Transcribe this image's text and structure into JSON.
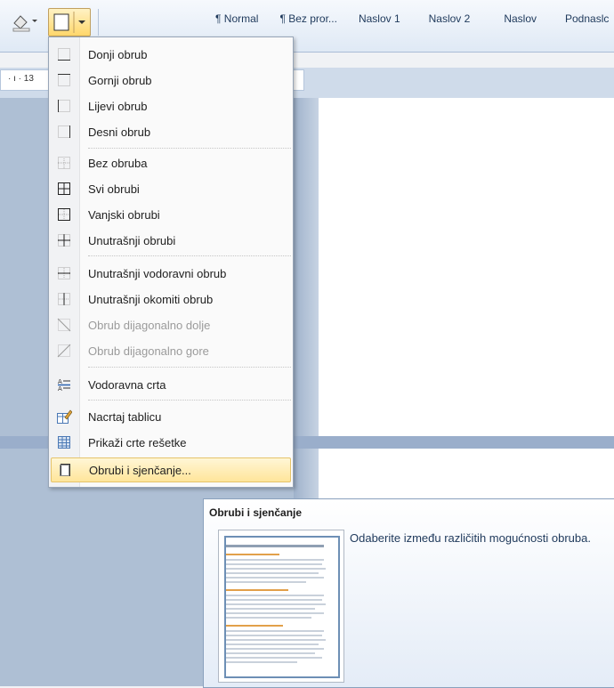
{
  "ribbon": {
    "styles": [
      "¶ Normal",
      "¶ Bez pror...",
      "Naslov 1",
      "Naslov 2",
      "Naslov",
      "Podnaslc"
    ]
  },
  "ruler": {
    "text": "· ı · 13"
  },
  "menu": {
    "items": [
      {
        "label": "Donji obrub",
        "icon": "border-bottom-icon",
        "disabled": false
      },
      {
        "label": "Gornji obrub",
        "icon": "border-top-icon",
        "disabled": false
      },
      {
        "label": "Lijevi obrub",
        "icon": "border-left-icon",
        "disabled": false
      },
      {
        "label": "Desni obrub",
        "icon": "border-right-icon",
        "disabled": false
      },
      {
        "label": "Bez obruba",
        "icon": "no-border-icon",
        "disabled": false
      },
      {
        "label": "Svi obrubi",
        "icon": "all-borders-icon",
        "disabled": false
      },
      {
        "label": "Vanjski obrubi",
        "icon": "outside-borders-icon",
        "disabled": false
      },
      {
        "label": "Unutrašnji obrubi",
        "icon": "inside-borders-icon",
        "disabled": false
      },
      {
        "label": "Unutrašnji vodoravni obrub",
        "icon": "inside-horizontal-border-icon",
        "disabled": false
      },
      {
        "label": "Unutrašnji okomiti obrub",
        "icon": "inside-vertical-border-icon",
        "disabled": false
      },
      {
        "label": "Obrub dijagonalno dolje",
        "icon": "diagonal-down-border-icon",
        "disabled": true
      },
      {
        "label": "Obrub dijagonalno gore",
        "icon": "diagonal-up-border-icon",
        "disabled": true
      },
      {
        "label": "Vodoravna crta",
        "icon": "horizontal-line-icon",
        "disabled": false
      },
      {
        "label": "Nacrtaj tablicu",
        "icon": "draw-table-icon",
        "disabled": false
      },
      {
        "label": "Prikaži crte rešetke",
        "icon": "view-gridlines-icon",
        "disabled": false
      },
      {
        "label": "Obrubi i sjenčanje...",
        "icon": "borders-shading-icon",
        "disabled": false
      }
    ]
  },
  "tooltip": {
    "title": "Obrubi i sjenčanje",
    "body": "Odaberite između različitih mogućnosti obruba."
  }
}
